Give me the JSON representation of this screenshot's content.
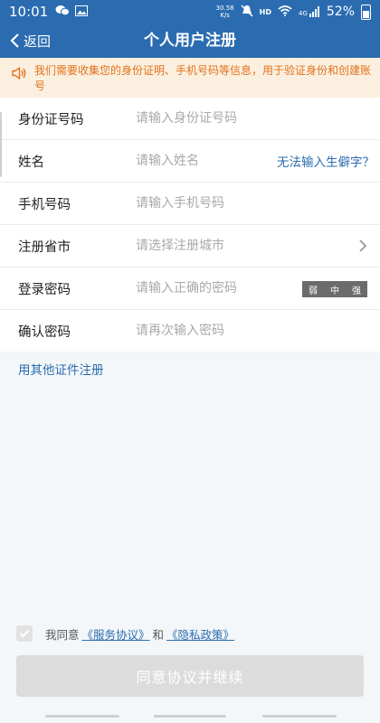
{
  "status_bar": {
    "time": "10:01",
    "net_speed_value": "30.58",
    "net_speed_unit": "K/s",
    "hd": "HD",
    "signal_type": "4G",
    "battery": "52%"
  },
  "nav": {
    "back_label": "返回",
    "title": "个人用户注册"
  },
  "notice": {
    "text": "我们需要收集您的身份证明、手机号码等信息，用于验证身份和创建账号"
  },
  "form": {
    "rows": [
      {
        "label": "身份证号码",
        "placeholder": "请输入身份证号码"
      },
      {
        "label": "姓名",
        "placeholder": "请输入姓名",
        "link": "无法输入生僻字？"
      },
      {
        "label": "手机号码",
        "placeholder": "请输入手机号码"
      },
      {
        "label": "注册省市",
        "placeholder": "请选择注册城市"
      },
      {
        "label": "登录密码",
        "placeholder": "请输入正确的密码",
        "strength": {
          "weak": "弱",
          "medium": "中",
          "strong": "强"
        }
      },
      {
        "label": "确认密码",
        "placeholder": "请再次输入密码"
      }
    ]
  },
  "other_cert_link": "用其他证件注册",
  "agreement": {
    "prefix": "我同意",
    "service": "《服务协议》",
    "and": "和",
    "privacy": "《隐私政策》",
    "checked": true
  },
  "submit_label": "同意协议并继续",
  "colors": {
    "primary": "#2b6cb0",
    "notice_text": "#e2711d",
    "notice_bg": "#fbf0df",
    "disabled_button": "#dcdcdc"
  }
}
